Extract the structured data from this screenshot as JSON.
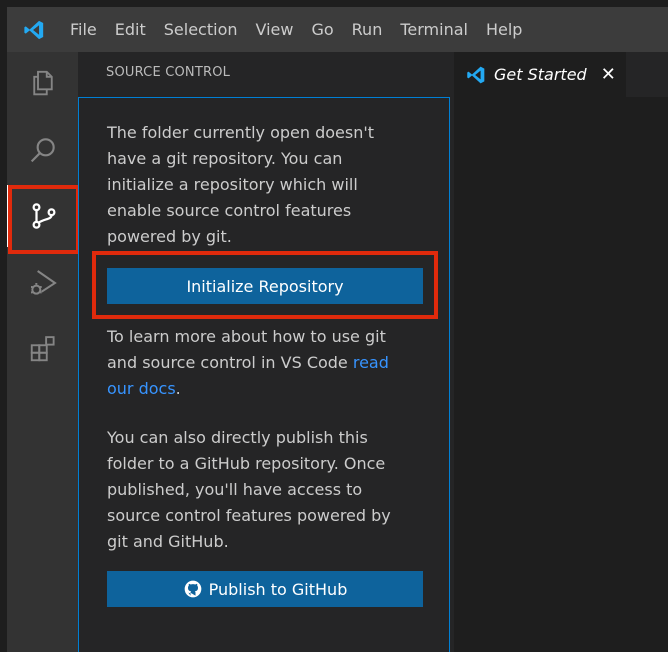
{
  "menu": {
    "items": [
      "File",
      "Edit",
      "Selection",
      "View",
      "Go",
      "Run",
      "Terminal",
      "Help"
    ]
  },
  "activity": {
    "icons": [
      "explorer-icon",
      "search-icon",
      "source-control-icon",
      "run-debug-icon",
      "extensions-icon"
    ],
    "active": "source-control-icon"
  },
  "sidebar": {
    "title": "SOURCE CONTROL",
    "intro": "The folder currently open doesn't have a git repository. You can initialize a repository which will enable source control features powered by git.",
    "init_button": "Initialize Repository",
    "learn_prefix": "To learn more about how to use git and source control in VS Code ",
    "learn_link": "read our docs",
    "learn_suffix": ".",
    "publish_text": "You can also directly publish this folder to a GitHub repository. Once published, you'll have access to source control features powered by git and GitHub.",
    "publish_button": "Publish to GitHub"
  },
  "editor": {
    "tab_label": "Get Started",
    "tab_close": "✕"
  },
  "colors": {
    "accent": "#0e639c",
    "highlight": "#e02a0c",
    "link": "#3794ff"
  }
}
